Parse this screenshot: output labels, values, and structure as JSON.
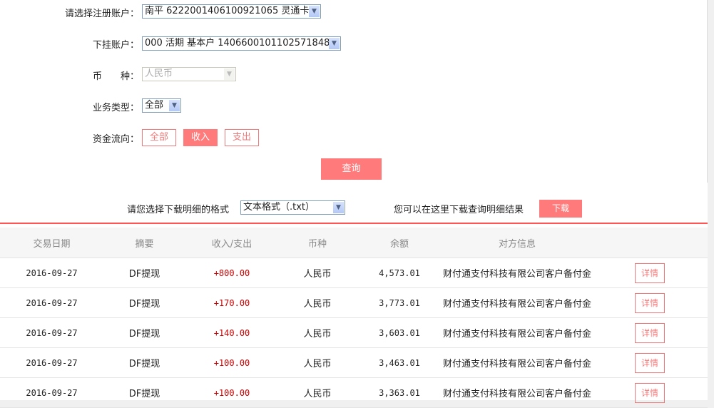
{
  "form": {
    "account_label": "请选择注册账户：",
    "account_value": "南平 6222001406100921065 灵通卡",
    "sub_label": "下挂账户：",
    "sub_value": "000 活期 基本户 1406600101102571848",
    "currency_label": "币　　种：",
    "currency_value": "人民币",
    "type_label": "业务类型：",
    "type_value": "全部",
    "flow_label": "资金流向：",
    "flow_options": [
      "全部",
      "收入",
      "支出"
    ],
    "flow_selected": "收入",
    "query": "查询"
  },
  "download": {
    "format_label": "请您选择下载明细的格式",
    "format_value": "文本格式（.txt）",
    "hint": "您可以在这里下载查询明细结果",
    "button": "下载"
  },
  "table": {
    "headers": [
      "交易日期",
      "摘要",
      "收入/支出",
      "币种",
      "余额",
      "对方信息",
      ""
    ],
    "rows": [
      {
        "date": "2016-09-27",
        "summary": "DF提现",
        "amount": "+800.00",
        "currency": "人民币",
        "balance": "4,573.01",
        "party": "财付通支付科技有限公司客户备付金",
        "action": "详情"
      },
      {
        "date": "2016-09-27",
        "summary": "DF提现",
        "amount": "+170.00",
        "currency": "人民币",
        "balance": "3,773.01",
        "party": "财付通支付科技有限公司客户备付金",
        "action": "详情"
      },
      {
        "date": "2016-09-27",
        "summary": "DF提现",
        "amount": "+140.00",
        "currency": "人民币",
        "balance": "3,603.01",
        "party": "财付通支付科技有限公司客户备付金",
        "action": "详情"
      },
      {
        "date": "2016-09-27",
        "summary": "DF提现",
        "amount": "+100.00",
        "currency": "人民币",
        "balance": "3,463.01",
        "party": "财付通支付科技有限公司客户备付金",
        "action": "详情"
      },
      {
        "date": "2016-09-27",
        "summary": "DF提现",
        "amount": "+100.00",
        "currency": "人民币",
        "balance": "3,363.01",
        "party": "财付通支付科技有限公司客户备付金",
        "action": "详情"
      }
    ]
  },
  "colors": {
    "accent": "#ff7b7b",
    "amount": "#cc0000"
  }
}
